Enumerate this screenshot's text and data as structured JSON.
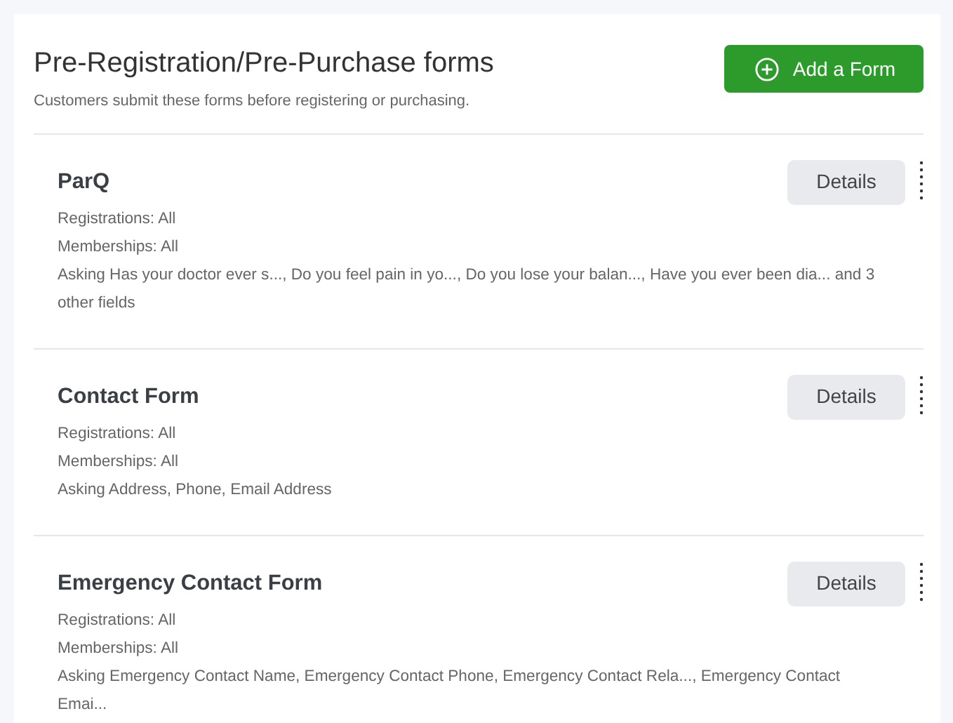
{
  "header": {
    "title": "Pre-Registration/Pre-Purchase forms",
    "subtitle": "Customers submit these forms before registering or purchasing.",
    "add_button": "Add a Form"
  },
  "forms": [
    {
      "name": "ParQ",
      "registrations": "Registrations: All",
      "memberships": "Memberships: All",
      "asking": "Asking Has your doctor ever s..., Do you feel pain in yo..., Do you lose your balan..., Have you ever been dia... and 3 other fields",
      "button": "Details"
    },
    {
      "name": "Contact Form",
      "registrations": "Registrations: All",
      "memberships": "Memberships: All",
      "asking": "Asking Address, Phone, Email Address",
      "button": "Details"
    },
    {
      "name": "Emergency Contact Form",
      "registrations": "Registrations: All",
      "memberships": "Memberships: All",
      "asking": "Asking Emergency Contact Name, Emergency Contact Phone, Emergency Contact Rela..., Emergency Contact Emai...",
      "button": "Details"
    }
  ]
}
